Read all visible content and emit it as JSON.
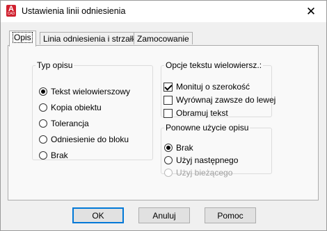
{
  "window": {
    "title": "Ustawienia linii odniesienia",
    "icon": "autocad-app-icon",
    "icon_letter": "A",
    "icon_sub": "CAD",
    "close_glyph": "✕"
  },
  "tabs": [
    {
      "label": "Opis",
      "active": true
    },
    {
      "label": "Linia odniesienia i strzałka",
      "active": false
    },
    {
      "label": "Zamocowanie",
      "active": false
    }
  ],
  "typ_opisu": {
    "legend": "Typ opisu",
    "options": [
      {
        "label": "Tekst wielowierszowy",
        "checked": true
      },
      {
        "label": "Kopia obiektu",
        "checked": false
      },
      {
        "label": "Tolerancja",
        "checked": false
      },
      {
        "label": "Odniesienie do bloku",
        "checked": false
      },
      {
        "label": "Brak",
        "checked": false
      }
    ]
  },
  "opcje_tekstu": {
    "legend": "Opcje tekstu wielowiersz.:",
    "options": [
      {
        "label": "Monituj o szerokość",
        "checked": true
      },
      {
        "label": "Wyrównaj zawsze do lewej",
        "checked": false
      },
      {
        "label": "Obramuj tekst",
        "checked": false
      }
    ]
  },
  "ponowne_uzycie": {
    "legend": "Ponowne użycie opisu",
    "options": [
      {
        "label": "Brak",
        "checked": true,
        "disabled": false
      },
      {
        "label": "Użyj następnego",
        "checked": false,
        "disabled": false
      },
      {
        "label": "Użyj bieżącego",
        "checked": false,
        "disabled": true
      }
    ]
  },
  "buttons": {
    "ok": "OK",
    "cancel": "Anuluj",
    "help": "Pomoc"
  },
  "colors": {
    "accent": "#0078d7",
    "icon_red": "#d0212f"
  }
}
